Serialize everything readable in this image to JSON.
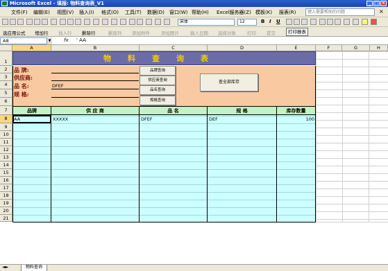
{
  "window": {
    "title": "Microsoft Excel - 填报: 物料查询表_V1"
  },
  "menu": {
    "items": [
      "文件(F)",
      "编辑(E)",
      "视图(V)",
      "插入(I)",
      "格式(O)",
      "工具(T)",
      "数据(D)",
      "窗口(W)",
      "帮助(H)",
      "Excel服务器(Z)",
      "模板(K)",
      "报表(R)"
    ],
    "help_placeholder": "键入需要帮助的问题"
  },
  "toolbar": {
    "font": "宋体",
    "size": "12"
  },
  "toolbar2": {
    "items": [
      {
        "label": "选应用公式",
        "disabled": false
      },
      {
        "label": "增加行",
        "disabled": false
      },
      {
        "label": "插入行",
        "disabled": true
      },
      {
        "label": "删除行",
        "disabled": false
      },
      {
        "label": "删除列",
        "disabled": true
      },
      {
        "label": "添加附件",
        "disabled": true
      },
      {
        "label": "添加图片",
        "disabled": true
      },
      {
        "label": "输入日期",
        "disabled": true
      },
      {
        "label": "选择对象",
        "disabled": true
      },
      {
        "label": "打印",
        "disabled": true
      },
      {
        "label": "提交",
        "disabled": true
      },
      {
        "label": "打印报表",
        "disabled": false
      }
    ]
  },
  "formula_bar": {
    "cell_ref": "A8",
    "fx": "fx",
    "value": "' AA"
  },
  "columns": [
    "A",
    "B",
    "C",
    "D",
    "E",
    "F",
    "G",
    "H"
  ],
  "rows": [
    "1",
    "2",
    "3",
    "4",
    "5",
    "6",
    "7",
    "8",
    "9",
    "10",
    "11",
    "12",
    "13",
    "14",
    "15",
    "16",
    "17",
    "18",
    "19",
    "20",
    "21"
  ],
  "sheet": {
    "title": "物料查询表",
    "fields": [
      {
        "label": "品  牌:",
        "value": ""
      },
      {
        "label": "供应商:",
        "value": ""
      },
      {
        "label": "品  名:",
        "value": "DFEF"
      },
      {
        "label": "规  格:",
        "value": ""
      }
    ],
    "query_buttons": [
      "品牌查询",
      "供应商查询",
      "品名查询",
      "规格查询"
    ],
    "all_stock_button": "查全部库存",
    "table_headers": [
      "品牌",
      "供 应 商",
      "品 名",
      "规 格",
      "库存数量"
    ],
    "rows": [
      {
        "brand": "AA",
        "supplier": "XXXXX",
        "name": "DFEF",
        "spec": "DEF",
        "qty": "100"
      }
    ]
  },
  "sheet_tab": "物料查询",
  "colors": {
    "title_bg": "#6c6ca8",
    "title_text": "#f2d000",
    "panel_bg": "#f9c9a1",
    "header_bg": "#c5f0c8",
    "body_bg": "#ccffff"
  }
}
